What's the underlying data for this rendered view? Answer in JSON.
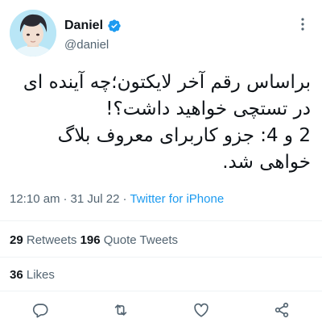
{
  "author": {
    "display_name": "Daniel",
    "handle": "@daniel",
    "verified_icon": "verified-badge-icon",
    "avatar_desc": "avatar"
  },
  "tweet": {
    "lines": [
      "براساس رقم آخر لایکتون؛چه آینده ای",
      "در تستچی خواهید داشت؟!",
      "2 و 4: جزو کاربرای معروف بلاگ",
      "خواهی شد."
    ],
    "time": "12:10 am",
    "separator": "·",
    "date": "31 Jul 22",
    "source": "Twitter for iPhone"
  },
  "stats": {
    "retweets_count": "29",
    "retweets_label": "Retweets",
    "quotes_count": "196",
    "quotes_label": "Quote Tweets",
    "likes_count": "36",
    "likes_label": "Likes"
  },
  "actions": [
    "reply-icon",
    "retweet-icon",
    "like-icon",
    "share-icon"
  ],
  "colors": {
    "accent": "#1d9bf0",
    "secondary_text": "#536471",
    "divider": "#eff3f4"
  }
}
